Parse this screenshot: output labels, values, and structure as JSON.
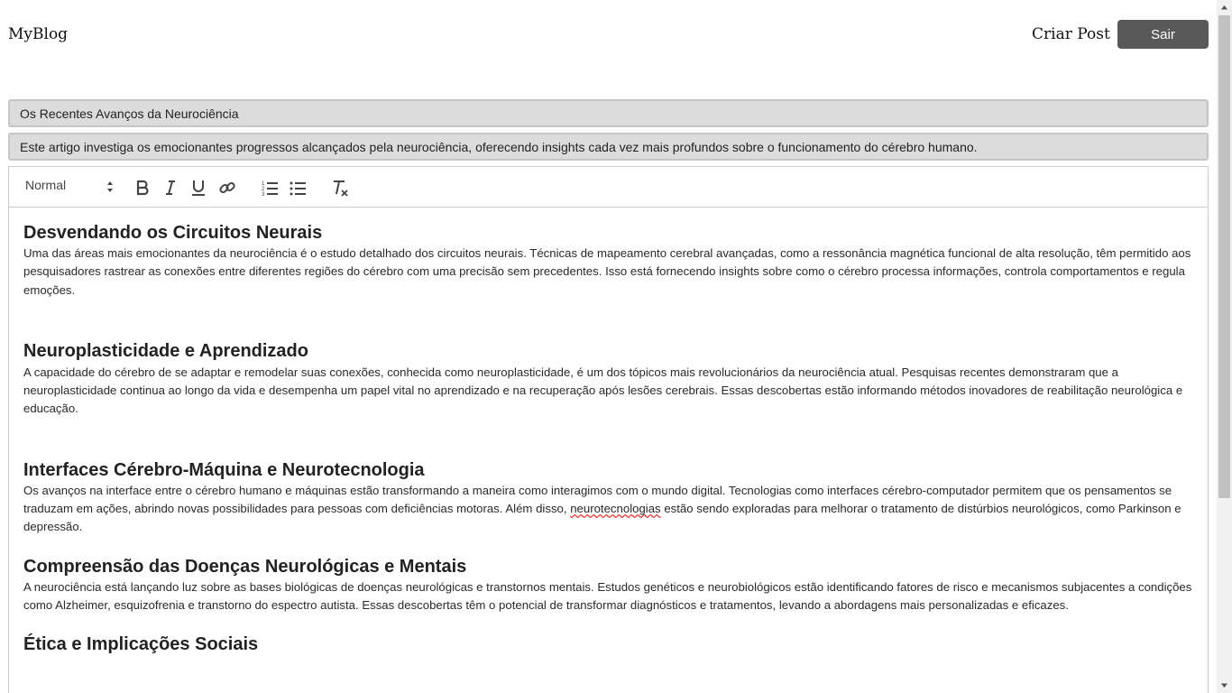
{
  "header": {
    "brand": "MyBlog",
    "create_post": "Criar Post",
    "logout": "Sair"
  },
  "form": {
    "title_value": "Os Recentes Avanços da Neurociência",
    "summary_value": "Este artigo investiga os emocionantes progressos alcançados pela neurociência, oferecendo insights cada vez mais profundos sobre o funcionamento do cérebro humano."
  },
  "toolbar": {
    "format_selected": "Normal",
    "buttons": [
      "bold-icon",
      "italic-icon",
      "underline-icon",
      "link-icon",
      "ordered-list-icon",
      "bullet-list-icon",
      "clear-format-icon"
    ]
  },
  "article": {
    "sections": [
      {
        "heading": "Desvendando os Circuitos Neurais",
        "body": "Uma das áreas mais emocionantes da neurociência é o estudo detalhado dos circuitos neurais. Técnicas de mapeamento cerebral avançadas, como a ressonância magnética funcional de alta resolução, têm permitido aos pesquisadores rastrear as conexões entre diferentes regiões do cérebro com uma precisão sem precedentes. Isso está fornecendo insights sobre como o cérebro processa informações, controla comportamentos e regula emoções."
      },
      {
        "heading": "Neuroplasticidade e Aprendizado",
        "body": "A capacidade do cérebro de se adaptar e remodelar suas conexões, conhecida como neuroplasticidade, é um dos tópicos mais revolucionários da neurociência atual. Pesquisas recentes demonstraram que a neuroplasticidade continua ao longo da vida e desempenha um papel vital no aprendizado e na recuperação após lesões cerebrais. Essas descobertas estão informando métodos inovadores de reabilitação neurológica e educação."
      },
      {
        "heading": "Interfaces Cérebro-Máquina e Neurotecnologia",
        "body_before": "Os avanços na interface entre o cérebro humano e máquinas estão transformando a maneira como interagimos com o mundo digital. Tecnologias como interfaces cérebro-computador permitem que os pensamentos se traduzam em ações, abrindo novas possibilidades para pessoas com deficiências motoras. Além disso, ",
        "body_flagged": "neurotecnologias",
        "body_after": " estão sendo exploradas para melhorar o tratamento de distúrbios neurológicos, como Parkinson e depressão."
      },
      {
        "heading": "Compreensão das Doenças Neurológicas e Mentais",
        "body": "A neurociência está lançando luz sobre as bases biológicas de doenças neurológicas e transtornos mentais. Estudos genéticos e neurobiológicos estão identificando fatores de risco e mecanismos subjacentes a condições como Alzheimer, esquizofrenia e transtorno do espectro autista. Essas descobertas têm o potencial de transformar diagnósticos e tratamentos, levando a abordagens mais personalizadas e eficazes."
      },
      {
        "heading": "Ética e Implicações Sociais"
      }
    ]
  },
  "colors": {
    "logout_bg": "#595959",
    "field_bg": "#dcdcdc",
    "spellcheck": "#e23b3b"
  }
}
